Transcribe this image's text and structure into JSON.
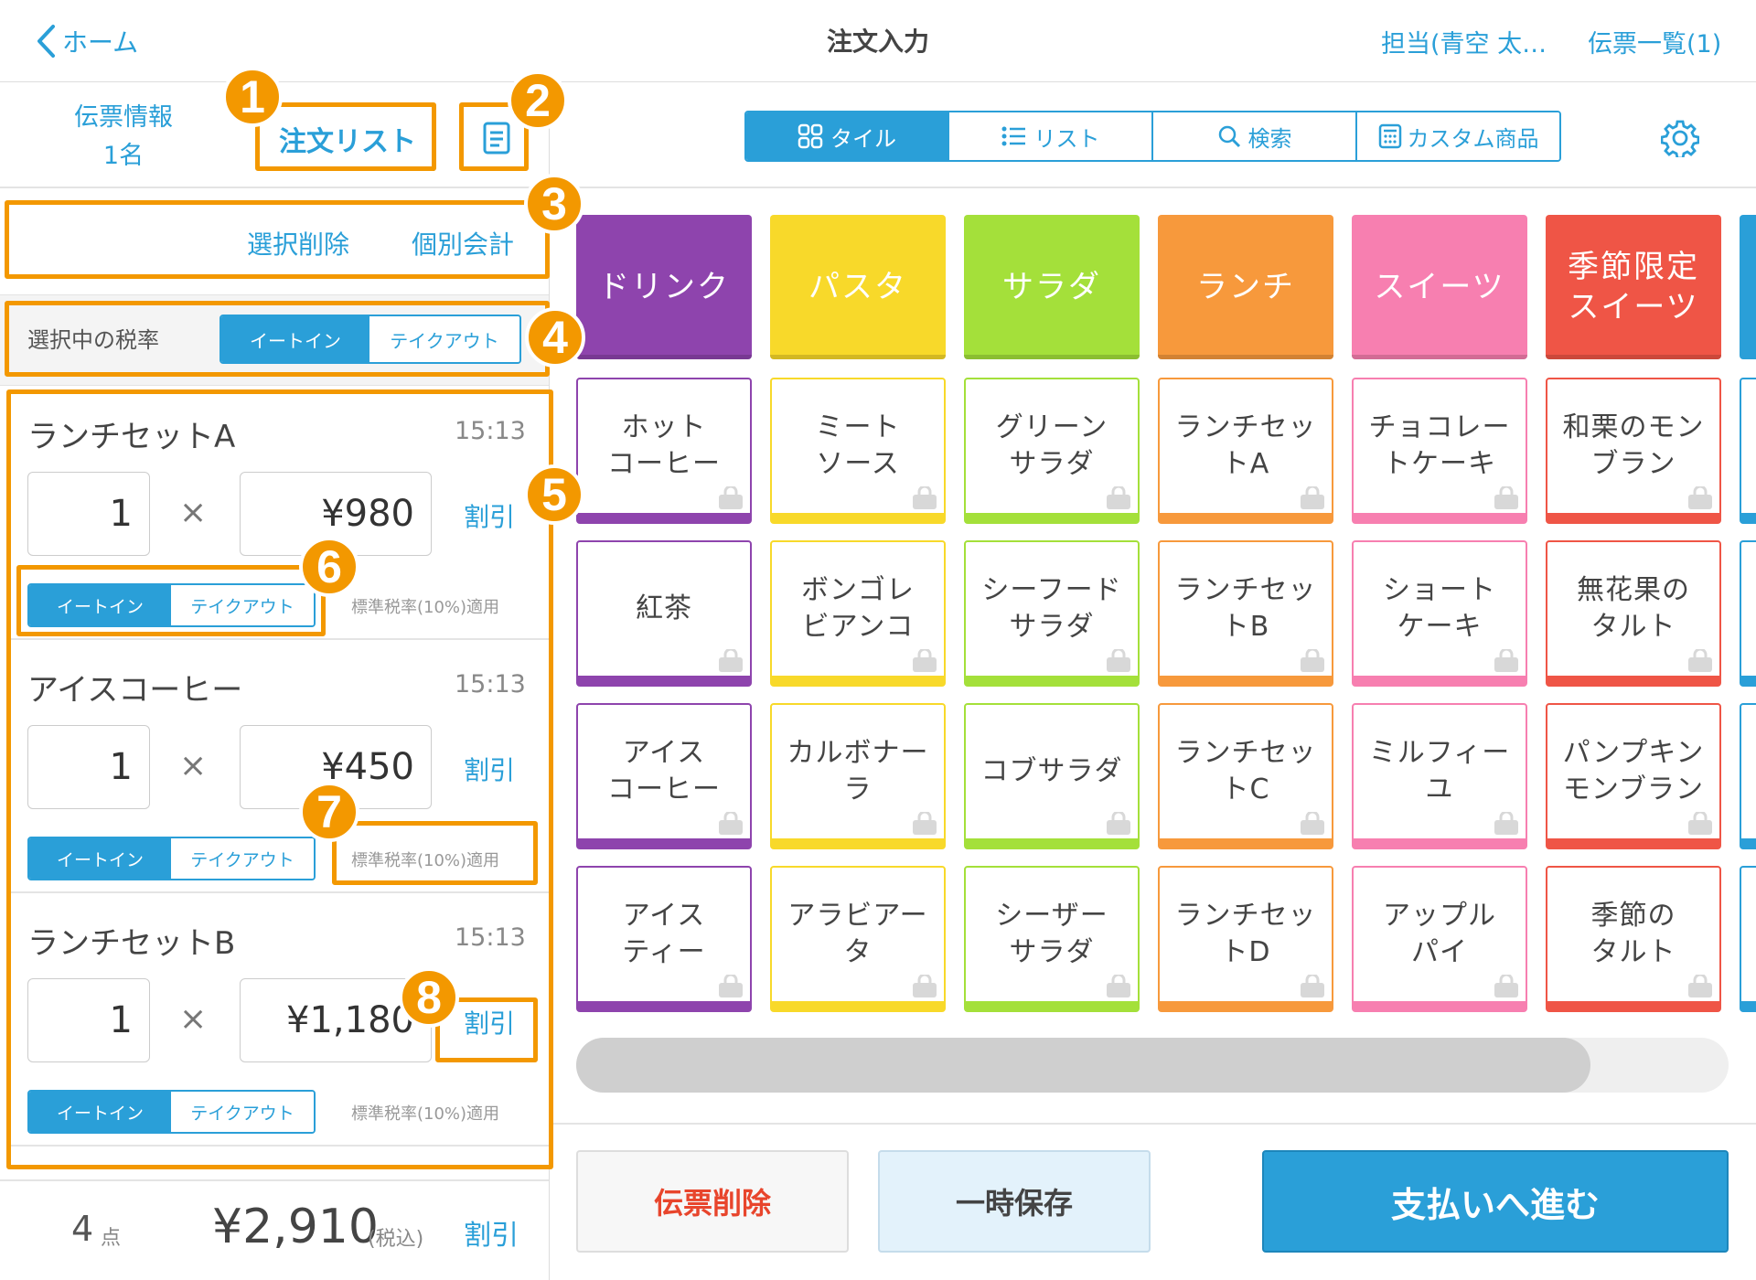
{
  "header": {
    "back_label": "ホーム",
    "title": "注文入力",
    "staff_label": "担当(青空 太…",
    "slips_label": "伝票一覧(1)"
  },
  "left": {
    "tabs": {
      "info_line1": "伝票情報",
      "info_line2": "1名",
      "order_list": "注文リスト"
    },
    "actions": {
      "delete_selected": "選択削除",
      "separate_pay": "個別会計"
    },
    "tax_rate": {
      "label": "選択中の税率",
      "eat_in": "イートイン",
      "takeout": "テイクアウト",
      "selected": "eat_in"
    },
    "items": [
      {
        "name": "ランチセットA",
        "time": "15:13",
        "qty": "1",
        "times": "×",
        "price": "¥980",
        "discount": "割引",
        "eat_in": "イートイン",
        "takeout": "テイクアウト",
        "tax_note": "標準税率(10%)適用"
      },
      {
        "name": "アイスコーヒー",
        "time": "15:13",
        "qty": "1",
        "times": "×",
        "price": "¥450",
        "discount": "割引",
        "eat_in": "イートイン",
        "takeout": "テイクアウト",
        "tax_note": "標準税率(10%)適用"
      },
      {
        "name": "ランチセットB",
        "time": "15:13",
        "qty": "1",
        "times": "×",
        "price": "¥1,180",
        "discount": "割引",
        "eat_in": "イートイン",
        "takeout": "テイクアウト",
        "tax_note": "標準税率(10%)適用"
      }
    ],
    "footer": {
      "count": "4",
      "count_unit": "点",
      "total": "¥2,910",
      "tax_incl": "(税込)",
      "discount": "割引"
    }
  },
  "right": {
    "view_tabs": [
      "タイル",
      "リスト",
      "検索",
      "カスタム商品"
    ],
    "active_tab": 0,
    "categories": [
      {
        "label": "ドリンク",
        "color": "#8e44ad"
      },
      {
        "label": "パスタ",
        "color": "#f8d92a"
      },
      {
        "label": "サラダ",
        "color": "#a4e03a"
      },
      {
        "label": "ランチ",
        "color": "#f7993c"
      },
      {
        "label": "スイーツ",
        "color": "#f77fb0"
      },
      {
        "label": "季節限定\nスイーツ",
        "color": "#ef5546"
      }
    ],
    "products": [
      [
        "ホット\nコーヒー",
        "紅茶",
        "アイス\nコーヒー",
        "アイス\nティー"
      ],
      [
        "ミート\nソース",
        "ボンゴレ\nビアンコ",
        "カルボナー\nラ",
        "アラビアー\nタ"
      ],
      [
        "グリーン\nサラダ",
        "シーフード\nサラダ",
        "コブサラダ",
        "シーザー\nサラダ"
      ],
      [
        "ランチセッ\nトA",
        "ランチセッ\nトB",
        "ランチセッ\nトC",
        "ランチセッ\nトD"
      ],
      [
        "チョコレー\nトケーキ",
        "ショート\nケーキ",
        "ミルフィー\nユ",
        "アップル\nパイ"
      ],
      [
        "和栗のモン\nブラン",
        "無花果の\nタルト",
        "パンプキン\nモンブラン",
        "季節の\nタルト"
      ]
    ],
    "scroll_position": 0.92,
    "buttons": {
      "delete_slip": "伝票削除",
      "hold": "一時保存",
      "pay": "支払いへ進む"
    }
  },
  "annotations": [
    "1",
    "2",
    "3",
    "4",
    "5",
    "6",
    "7",
    "8"
  ],
  "colors": {
    "accent": "#2a9fd8",
    "annotation": "#f39800",
    "delete_text": "#e8452c"
  }
}
